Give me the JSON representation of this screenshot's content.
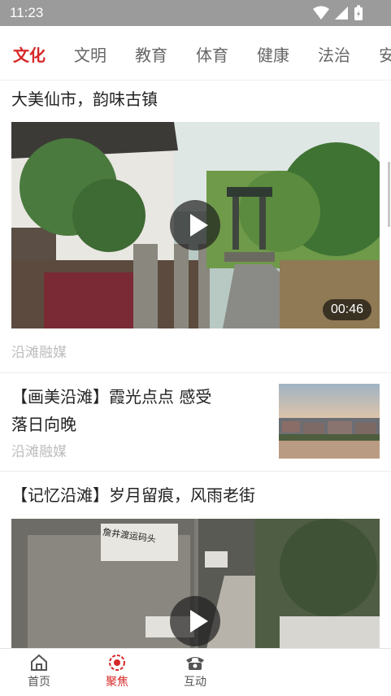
{
  "status_bar": {
    "time": "11:23"
  },
  "tabs": [
    {
      "label": "文化",
      "active": true
    },
    {
      "label": "文明",
      "active": false
    },
    {
      "label": "教育",
      "active": false
    },
    {
      "label": "体育",
      "active": false
    },
    {
      "label": "健康",
      "active": false
    },
    {
      "label": "法治",
      "active": false
    },
    {
      "label": "安",
      "active": false
    }
  ],
  "feed": [
    {
      "title": "大美仙市，韵味古镇",
      "source": "沿滩融媒",
      "duration": "00:46",
      "type": "video"
    },
    {
      "title": "【画美沿滩】霞光点点  感受落日向晚",
      "title_line1": "【画美沿滩】霞光点点  感受",
      "title_line2": "落日向晚",
      "source": "沿滩融媒",
      "type": "thumbnail"
    },
    {
      "title": "【记忆沿滩】岁月留痕，风雨老街",
      "sign_text": "詹井渡运码头",
      "type": "video"
    }
  ],
  "bottom_nav": [
    {
      "label": "首页",
      "icon": "home-icon",
      "active": false
    },
    {
      "label": "聚焦",
      "icon": "focus-icon",
      "active": true
    },
    {
      "label": "互动",
      "icon": "phone-icon",
      "active": false
    }
  ],
  "colors": {
    "accent": "#d62828",
    "status_bar": "#9b9b9b",
    "source_text": "#bdbdbd"
  }
}
